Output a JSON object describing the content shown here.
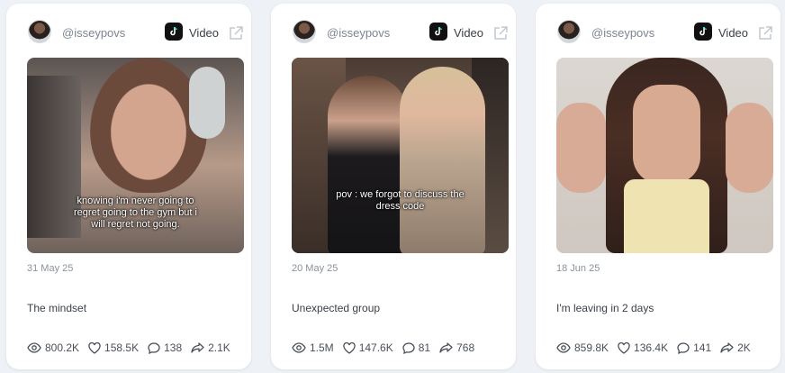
{
  "cards": [
    {
      "handle": "@isseypovs",
      "platform": "Video",
      "caption": "knowing i'm never going to regret going to the gym but i will regret not going.",
      "date": "31 May 25",
      "title": "The mindset",
      "views": "800.2K",
      "likes": "158.5K",
      "comments": "138",
      "shares": "2.1K"
    },
    {
      "handle": "@isseypovs",
      "platform": "Video",
      "caption": "pov : we forgot to discuss the dress code",
      "date": "20 May 25",
      "title": "Unexpected group",
      "views": "1.5M",
      "likes": "147.6K",
      "comments": "81",
      "shares": "768"
    },
    {
      "handle": "@isseypovs",
      "platform": "Video",
      "caption": "",
      "date": "18 Jun 25",
      "title": "I'm leaving in 2 days",
      "views": "859.8K",
      "likes": "136.4K",
      "comments": "141",
      "shares": "2K"
    }
  ],
  "icons": {
    "platform": "tiktok-icon",
    "external": "external-link-icon",
    "views": "eye-icon",
    "likes": "heart-icon",
    "comments": "comment-icon",
    "shares": "share-icon"
  }
}
